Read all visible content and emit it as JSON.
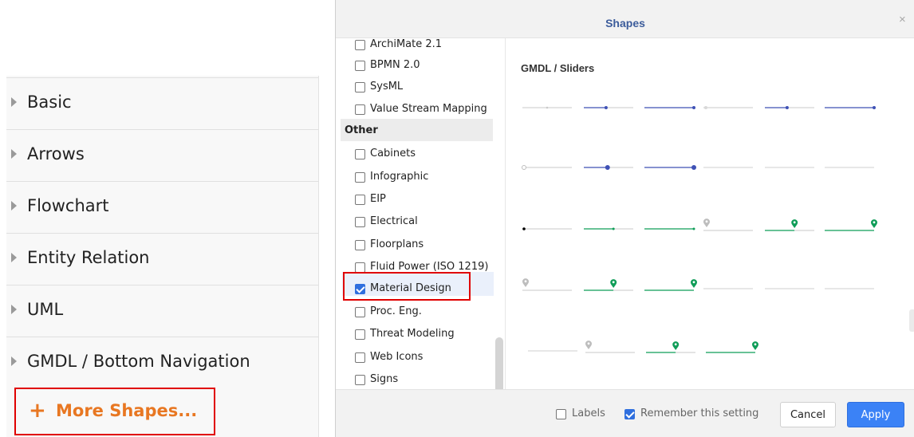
{
  "sidebar": {
    "categories": [
      "Basic",
      "Arrows",
      "Flowchart",
      "Entity Relation",
      "UML",
      "GMDL / Bottom Navigation"
    ],
    "more_shapes": {
      "icon": "+",
      "label": "More Shapes..."
    }
  },
  "dialog": {
    "title": "Shapes",
    "close_icon": "×",
    "libraries_top": [
      {
        "label": "ArchiMate 2.1",
        "checked": false
      },
      {
        "label": "BPMN 2.0",
        "checked": false
      },
      {
        "label": "SysML",
        "checked": false
      },
      {
        "label": "Value Stream Mapping",
        "checked": false
      }
    ],
    "section_other": "Other",
    "libraries_other": [
      {
        "label": "Cabinets",
        "checked": false
      },
      {
        "label": "Infographic",
        "checked": false
      },
      {
        "label": "EIP",
        "checked": false
      },
      {
        "label": "Electrical",
        "checked": false
      },
      {
        "label": "Floorplans",
        "checked": false
      },
      {
        "label": "Fluid Power (ISO 1219)",
        "checked": false
      },
      {
        "label": "Material Design",
        "checked": true
      },
      {
        "label": "Proc. Eng.",
        "checked": false
      },
      {
        "label": "Threat Modeling",
        "checked": false
      },
      {
        "label": "Web Icons",
        "checked": false
      },
      {
        "label": "Signs",
        "checked": false
      }
    ],
    "preview_title": "GMDL / Sliders",
    "preview_colors": {
      "blue": "#3f51b5",
      "green": "#0f9d58",
      "grey": "#bdbdbd",
      "black": "#000000"
    },
    "footer": {
      "labels_option": {
        "label": "Labels",
        "checked": false
      },
      "remember_option": {
        "label": "Remember this setting",
        "checked": true
      },
      "cancel_label": "Cancel",
      "apply_label": "Apply"
    }
  }
}
